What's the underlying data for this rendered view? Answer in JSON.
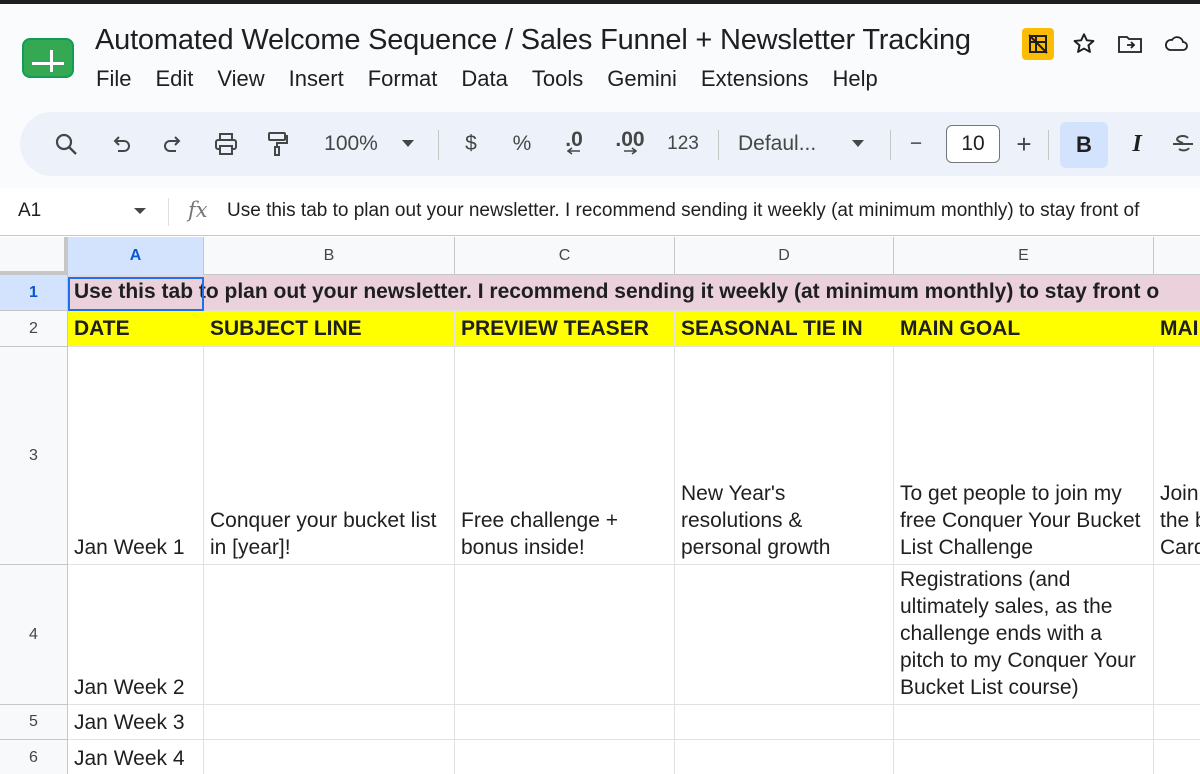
{
  "document": {
    "title": "Automated Welcome Sequence / Sales Funnel + Newsletter Tracking"
  },
  "menu": [
    "File",
    "Edit",
    "View",
    "Insert",
    "Format",
    "Data",
    "Tools",
    "Gemini",
    "Extensions",
    "Help"
  ],
  "toolbar": {
    "zoom": "100%",
    "currency": "$",
    "percent": "%",
    "decrease_decimal": ".0",
    "increase_decimal": ".00",
    "number_format": "123",
    "font": "Defaul...",
    "minus": "−",
    "font_size": "10",
    "plus": "+",
    "bold": "B",
    "italic": "I"
  },
  "formula_bar": {
    "cell_ref": "A1",
    "fx": "fx",
    "content": "Use this tab to plan out your newsletter. I recommend sending it weekly (at minimum monthly) to stay front of"
  },
  "columns": [
    "A",
    "B",
    "C",
    "D",
    "E"
  ],
  "rows": [
    "1",
    "2",
    "3",
    "4",
    "5",
    "6"
  ],
  "sheet": {
    "banner": "Use this tab to plan out your newsletter. I recommend sending it weekly (at minimum monthly) to stay front o",
    "headers": [
      "DATE",
      "SUBJECT LINE",
      "PREVIEW TEASER",
      "SEASONAL TIE IN",
      "MAIN GOAL",
      "MAI"
    ],
    "row3": {
      "date": "Jan Week 1",
      "subject": "Conquer your bucket list in [year]!",
      "teaser": "Free challenge + bonus inside!",
      "seasonal": "New Year's resolutions & personal growth",
      "goal": "To get people to join my free Conquer Your Bucket List Challenge",
      "extra": "Join the b Card"
    },
    "row4": {
      "date": "Jan Week 2",
      "goal": "Registrations (and ultimately sales, as the challenge ends with a pitch to my Conquer Your Bucket List course)"
    },
    "row5": {
      "date": "Jan Week 3"
    },
    "row6": {
      "date": "Jan Week 4"
    }
  }
}
